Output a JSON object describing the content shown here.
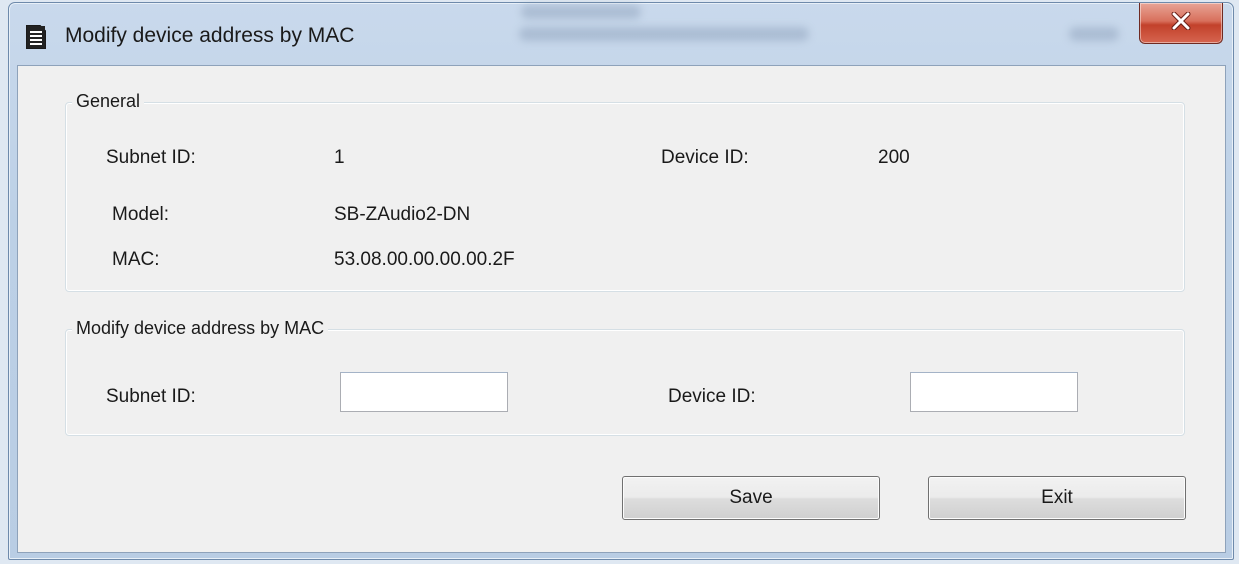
{
  "window": {
    "title": "Modify device address by MAC",
    "icons": {
      "app": "document-icon",
      "close": "close-icon"
    },
    "colors": {
      "close_button": "#c7432d",
      "client_background": "#f0f0f0"
    }
  },
  "general": {
    "legend": "General",
    "subnet_label": "Subnet ID:",
    "subnet_value": "1",
    "device_label": "Device ID:",
    "device_value": "200",
    "model_label": "Model:",
    "model_value": "SB-ZAudio2-DN",
    "mac_label": "MAC:",
    "mac_value": "53.08.00.00.00.00.2F"
  },
  "modify": {
    "legend": "Modify device address by MAC",
    "subnet_label": "Subnet ID:",
    "subnet_input_value": "",
    "device_label": "Device ID:",
    "device_input_value": ""
  },
  "buttons": {
    "save": "Save",
    "exit": "Exit"
  }
}
